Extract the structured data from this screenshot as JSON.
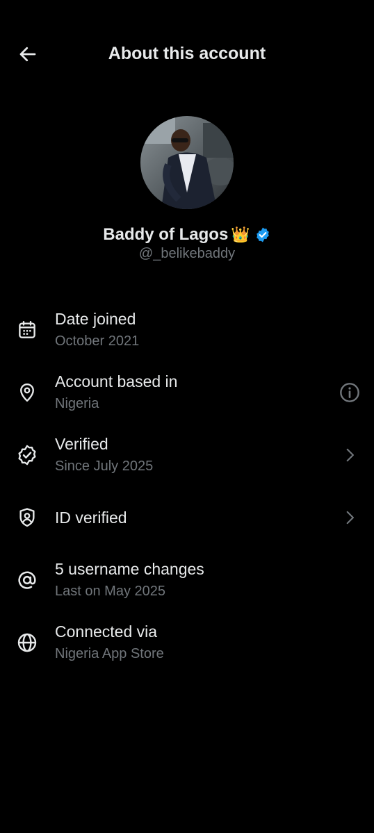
{
  "header": {
    "title": "About this account",
    "back_icon": "arrow-left-icon"
  },
  "profile": {
    "display_name": "Baddy of Lagos",
    "emoji": "👑",
    "handle": "@_belikebaddy",
    "verified_color": "#1d9bf0"
  },
  "rows": [
    {
      "icon": "calendar-icon",
      "title": "Date joined",
      "subtitle": "October 2021"
    },
    {
      "icon": "location-pin-icon",
      "title": "Account based in",
      "subtitle": "Nigeria",
      "action_icon": "info-icon"
    },
    {
      "icon": "verified-check-icon",
      "title": "Verified",
      "subtitle": "Since July 2025",
      "action_icon": "chevron-right-icon"
    },
    {
      "icon": "id-shield-icon",
      "title": "ID verified",
      "action_icon": "chevron-right-icon"
    },
    {
      "icon": "at-sign-icon",
      "title": "5 username changes",
      "subtitle": "Last on May 2025"
    },
    {
      "icon": "globe-icon",
      "title": "Connected via",
      "subtitle": "Nigeria App Store"
    }
  ],
  "colors": {
    "background": "#000000",
    "primary_text": "#e7e9ea",
    "secondary_text": "#71767b"
  }
}
